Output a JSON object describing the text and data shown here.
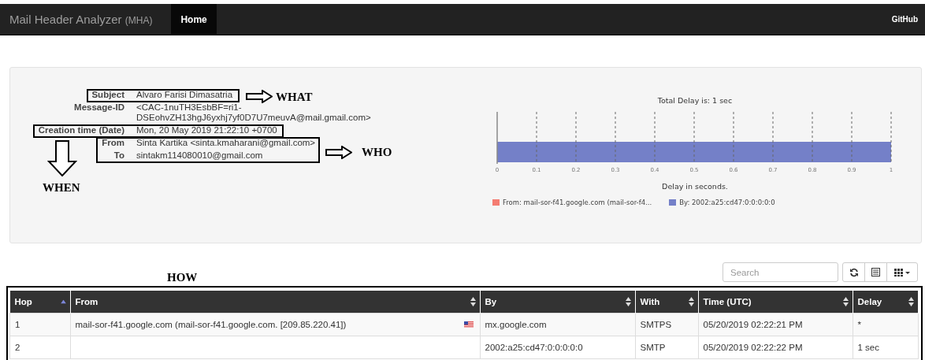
{
  "navbar": {
    "brand": "Mail Header Analyzer",
    "brand_suffix": "(MHA)",
    "tabs": [
      {
        "label": "Home",
        "selected": true
      }
    ],
    "right_link": "GitHub"
  },
  "summary": {
    "fields": [
      {
        "label": "Subject",
        "value": "Alvaro Farisi Dimasatria"
      },
      {
        "label": "Message-ID",
        "value": "<CAC-1nuTH3EsbBF=ri1-DSEohvZH13hgJ6yxhj7yf0D7U7meuvA@mail.gmail.com>"
      },
      {
        "label": "Creation time (Date)",
        "value": "Mon, 20 May 2019 21:22:10 +0700"
      },
      {
        "label": "From",
        "value": "Sinta Kartika <sinta.kmaharani@gmail.com>"
      },
      {
        "label": "To",
        "value": "sintakm114080010@gmail.com"
      }
    ],
    "chart_data": {
      "type": "bar",
      "orientation": "horizontal",
      "stacked": true,
      "title": "Total Delay is: 1 sec",
      "xlabel": "Delay in seconds.",
      "categories": [
        null
      ],
      "grid": true,
      "xlim": [
        0,
        1
      ],
      "xticks": [
        0,
        0.1,
        0.2,
        0.3,
        0.4,
        0.5,
        0.6,
        0.7,
        0.8,
        0.9,
        1
      ],
      "series": [
        {
          "name": "From: mail-sor-f41.google.com (mail-sor-f4...",
          "color": "#f47c72",
          "values": [
            0
          ]
        },
        {
          "name": "By: 2002:a25:cd47:0:0:0:0:0",
          "color": "#7480c8",
          "values": [
            1
          ]
        }
      ]
    }
  },
  "annotations": {
    "what": "WHAT",
    "who": "WHO",
    "when": "WHEN",
    "how": "HOW"
  },
  "toolbar": {
    "search": {
      "placeholder": "Search"
    }
  },
  "table": {
    "columns": [
      {
        "label": "Hop",
        "sorted": true
      },
      {
        "label": "From",
        "sorted": false
      },
      {
        "label": "By",
        "sorted": false
      },
      {
        "label": "With",
        "sorted": false
      },
      {
        "label": "Time (UTC)",
        "sorted": false
      },
      {
        "label": "Delay",
        "sorted": false
      }
    ],
    "rows": [
      {
        "hop": "1",
        "from": "mail-sor-f41.google.com (mail-sor-f41.google.com. [209.85.220.41])",
        "flag": true,
        "by": "mx.google.com",
        "with": "SMTPS",
        "time": "05/20/2019 02:22:21 PM",
        "delay": "*"
      },
      {
        "hop": "2",
        "from": "",
        "flag": false,
        "by": "2002:a25:cd47:0:0:0:0:0",
        "with": "SMTP",
        "time": "05/20/2019 02:22:22 PM",
        "delay": "1 sec"
      }
    ]
  }
}
